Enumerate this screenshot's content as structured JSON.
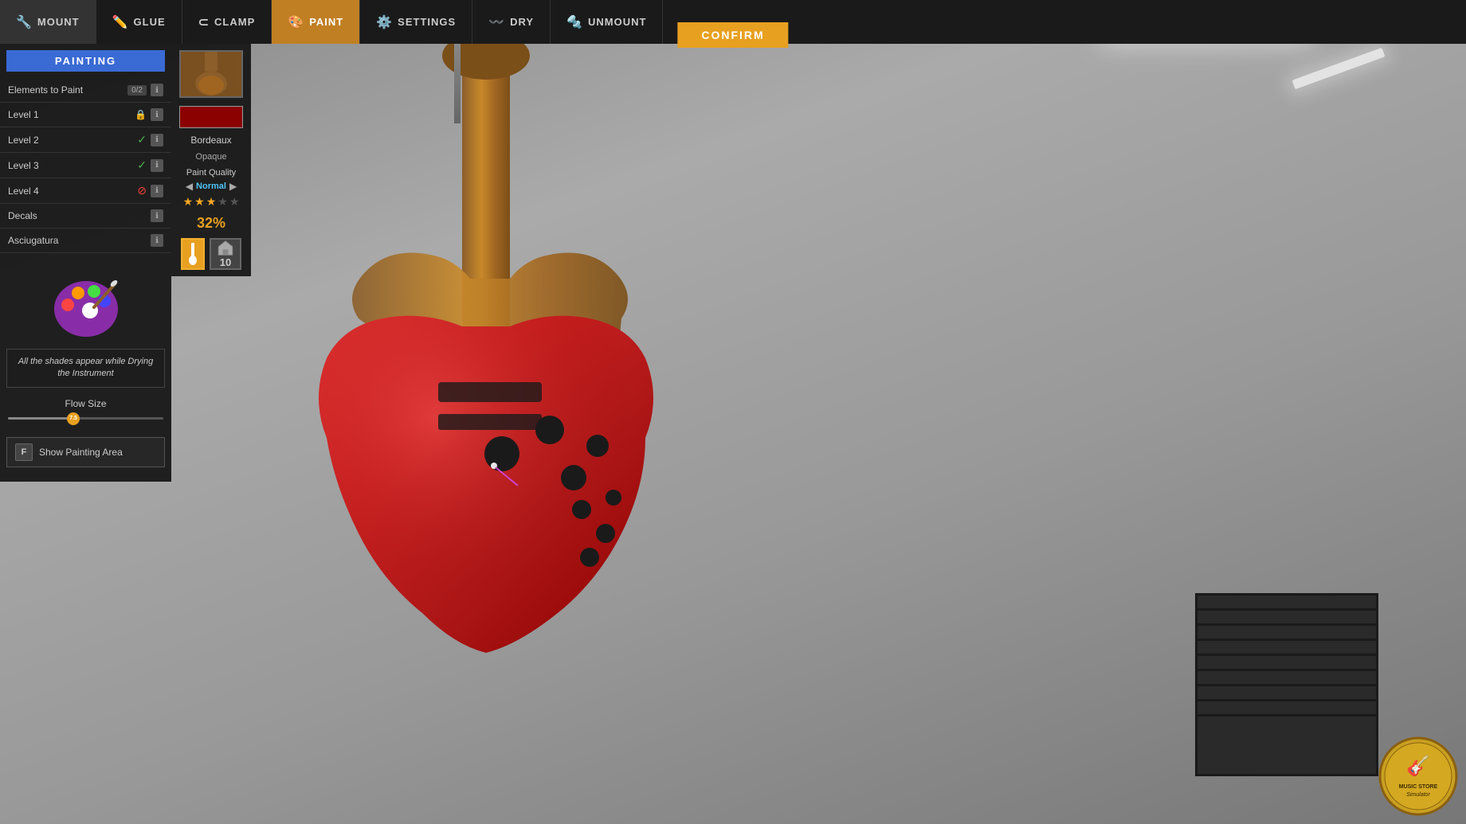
{
  "nav": {
    "items": [
      {
        "id": "mount",
        "label": "MOUNT",
        "icon": "🔧",
        "active": false
      },
      {
        "id": "glue",
        "label": "GLUE",
        "icon": "✏️",
        "active": false
      },
      {
        "id": "clamp",
        "label": "CLAMP",
        "icon": "⊂",
        "active": false
      },
      {
        "id": "paint",
        "label": "PAINT",
        "icon": "🎨",
        "active": true
      },
      {
        "id": "settings",
        "label": "SETTINGS",
        "icon": "⚙️",
        "active": false
      },
      {
        "id": "dry",
        "label": "DRY",
        "icon": "〰️",
        "active": false
      },
      {
        "id": "unmount",
        "label": "UNMOUNT",
        "icon": "🔩",
        "active": false
      }
    ],
    "confirm_label": "CONFIRM"
  },
  "left_panel": {
    "title": "PAINTING",
    "elements_to_paint": {
      "label": "Elements to Paint",
      "value": "0/2"
    },
    "levels": [
      {
        "label": "Level 1",
        "status": "lock"
      },
      {
        "label": "Level 2",
        "status": "ok"
      },
      {
        "label": "Level 3",
        "status": "ok"
      },
      {
        "label": "Level 4",
        "status": "warn"
      }
    ],
    "decals": {
      "label": "Decals"
    },
    "asciugatura": {
      "label": "Asciugatura"
    },
    "info_text": "All the shades appear while Drying the Instrument",
    "flow_size": {
      "label": "Flow Size",
      "value": "7.5"
    },
    "show_painting": {
      "key": "F",
      "label": "Show Painting Area"
    }
  },
  "right_panel": {
    "color_name": "Bordeaux",
    "color_hex": "#8B0000",
    "texture_note": "Opaque",
    "quality": {
      "label": "Paint Quality",
      "value": "Normal",
      "stars": 3,
      "max_stars": 5,
      "percent": "32%"
    },
    "tools": {
      "brush_count": "10"
    }
  },
  "logo": {
    "text": "MUSIC STORE\nSimulator"
  }
}
